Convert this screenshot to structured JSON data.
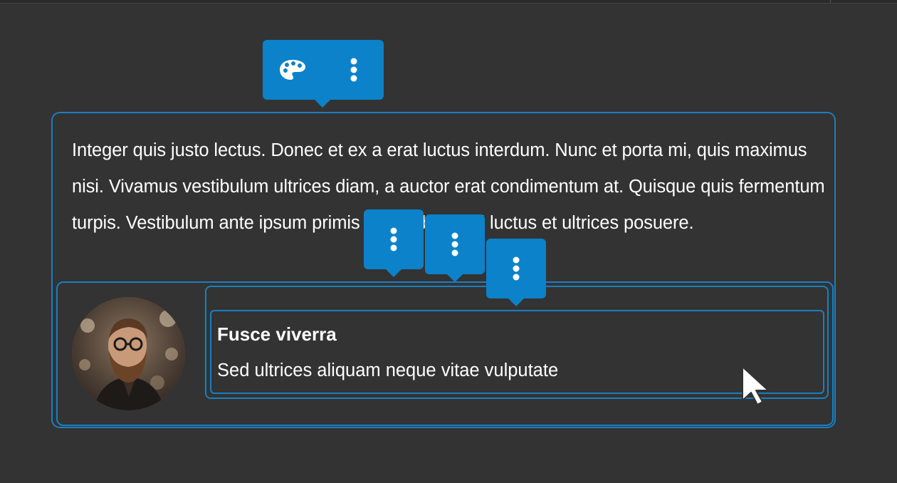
{
  "content": {
    "paragraph": "Integer quis justo lectus. Donec et ex a erat luctus interdum. Nunc et porta mi, quis maximus nisi. Vivamus vestibulum ultrices diam, a auctor erat condimentum at. Quisque quis fermentum turpis. Vestibulum ante ipsum primis in faucibus orci luctus et ultrices posuere.",
    "heading": "Fusce viverra",
    "body": "Sed ultrices aliquam neque vitae vulputate"
  },
  "toolbars": {
    "main": {
      "buttons": [
        {
          "icon": "palette-icon"
        },
        {
          "icon": "more-vertical-icon"
        }
      ]
    },
    "block_toolbars": [
      {
        "icon": "more-vertical-icon"
      },
      {
        "icon": "more-vertical-icon"
      },
      {
        "icon": "more-vertical-icon"
      }
    ]
  },
  "colors": {
    "background": "#333333",
    "accent": "#0b82c9",
    "outline": "#1a7fc1",
    "text": "#ffffff"
  }
}
